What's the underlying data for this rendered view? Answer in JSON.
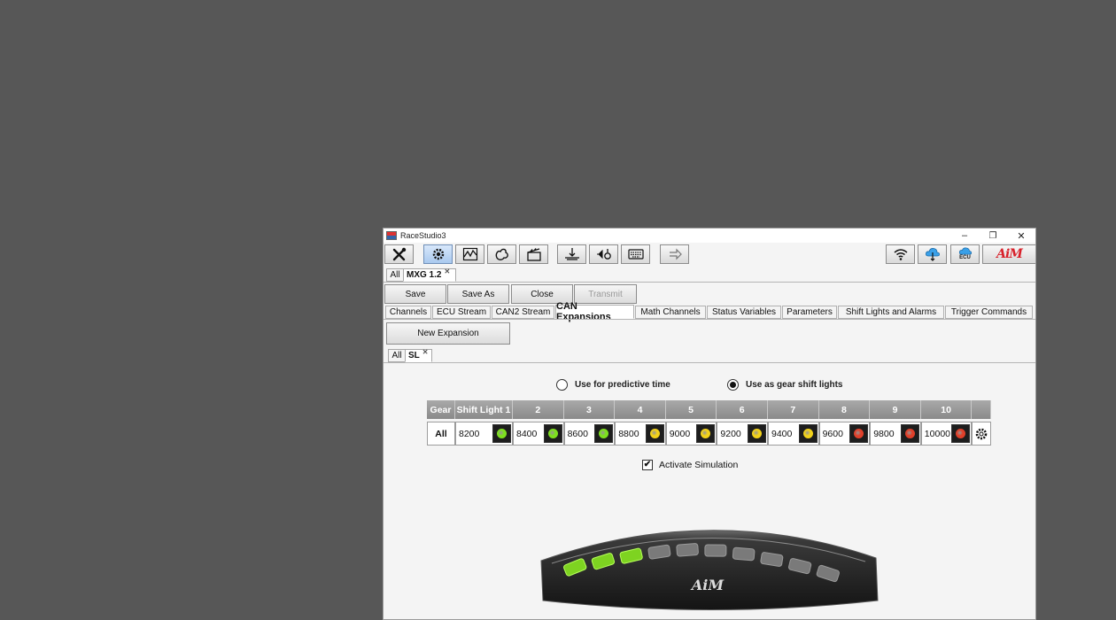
{
  "window": {
    "title": "RaceStudio3",
    "controls": [
      "–",
      "❐",
      "✕"
    ]
  },
  "toolbar": {
    "left_icons": [
      "wrench-screwdriver-icon",
      "gear-config-icon",
      "chart-icon",
      "track-map-icon",
      "clapperboard-icon",
      "download-icon",
      "plug-icon",
      "keyboard-icon",
      "transfer-icon"
    ],
    "right_icons": [
      "wifi-icon",
      "cloud-download-icon",
      "ecu-cloud-icon"
    ],
    "ecu_label": "ECU",
    "brand": "AiM"
  },
  "doc_tabs": {
    "all": "All",
    "active": "MXG 1.2"
  },
  "actions": {
    "save": "Save",
    "save_as": "Save As",
    "close": "Close",
    "transmit": "Transmit"
  },
  "config_tabs": [
    "Channels",
    "ECU Stream",
    "CAN2 Stream",
    "CAN Expansions",
    "Math Channels",
    "Status Variables",
    "Parameters",
    "Shift Lights and Alarms",
    "Trigger Commands"
  ],
  "config_tab_active": "CAN Expansions",
  "new_expansion": "New Expansion",
  "sub_tabs": {
    "all": "All",
    "active": "SL"
  },
  "radios": {
    "predictive": {
      "label": "Use for predictive time",
      "selected": false
    },
    "gear_shift": {
      "label": "Use as gear shift lights",
      "selected": true
    }
  },
  "shift_table": {
    "gear_header": "Gear",
    "headers": [
      "Shift Light 1",
      "2",
      "3",
      "4",
      "5",
      "6",
      "7",
      "8",
      "9",
      "10"
    ],
    "row_label": "All",
    "values": [
      "8200",
      "8400",
      "8600",
      "8800",
      "9000",
      "9200",
      "9400",
      "9600",
      "9800",
      "10000"
    ],
    "led_colors": [
      "green",
      "green",
      "green",
      "yellow",
      "yellow",
      "yellow",
      "yellow",
      "red",
      "red",
      "red"
    ]
  },
  "colors": {
    "green": "#7ee01e",
    "yellow": "#f2d21a",
    "red": "#e0402a"
  },
  "simulation": {
    "label": "Activate Simulation",
    "checked": true,
    "check_mark": "✔"
  },
  "device": {
    "lit_leds": 3,
    "total_leds": 10,
    "lit_color": "#7ed321",
    "brand": "AiM"
  }
}
